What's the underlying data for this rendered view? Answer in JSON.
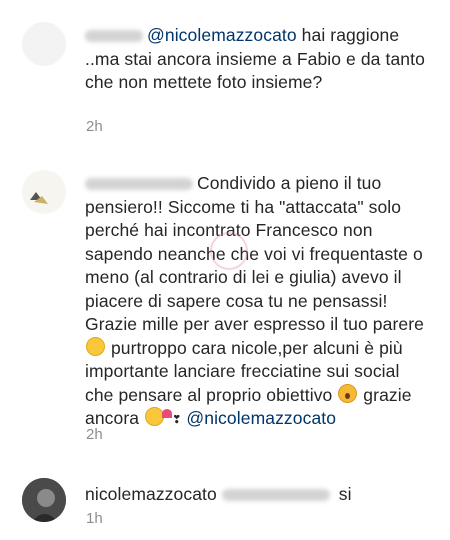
{
  "comments": [
    {
      "mention": "@nicolemazzocato",
      "text_after_mention": " hai raggione ..ma stai ancora insieme a Fabio e da tanto che non mettete foto insieme?",
      "time": "2h"
    },
    {
      "text": "Condivido a pieno il tuo pensiero!! Siccome ti ha \"attaccata\" solo perché hai incontrato Francesco non sapendo neanche che voi vi frequentaste o meno (al contrario di lei e giulia) avevo il piacere di sapere cosa tu ne pensassi! Grazie mille per aver espresso il tuo parere",
      "text_2": " purtroppo cara nicole,per alcuni è più importante lanciare frecciatine sui social che pensare al proprio obiettivo ",
      "text_3": " grazie ancora ",
      "mention": "@nicolemazzocato",
      "time": "2h"
    },
    {
      "username": "nicolemazzocato",
      "text": " si",
      "time": "1h"
    }
  ],
  "icons": {
    "hug": "hugging-face-icon",
    "scream": "screaming-face-icon",
    "heart": "heart-icon"
  }
}
